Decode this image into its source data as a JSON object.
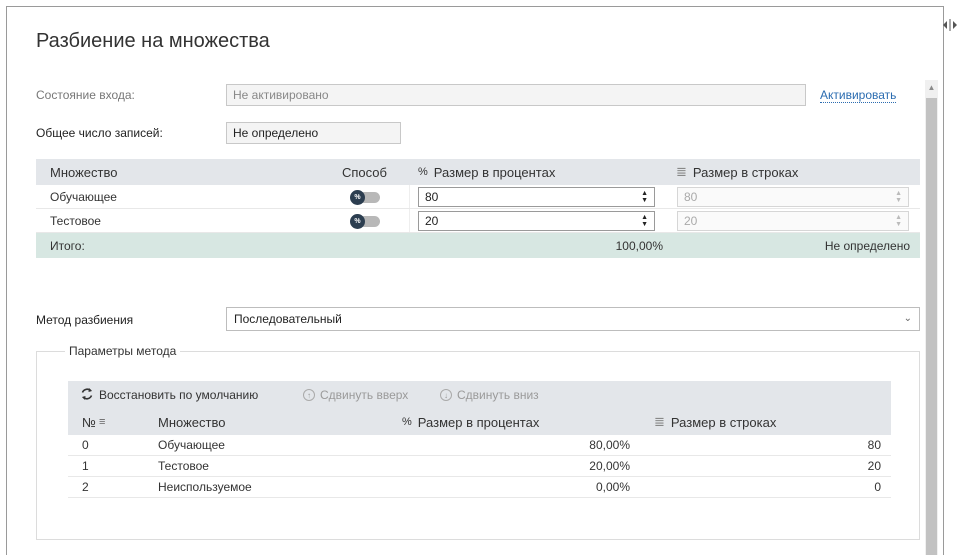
{
  "window": {
    "title": "Разбиение на множества"
  },
  "state": {
    "label": "Состояние входа:",
    "value": "Не активировано",
    "activate_link": "Активировать"
  },
  "records": {
    "label": "Общее число записей:",
    "value": "Не определено"
  },
  "split_table": {
    "headers": {
      "set": "Множество",
      "method": "Способ",
      "percent_icon": "%",
      "percent": "Размер в процентах",
      "rows_icon": "≣",
      "rows": "Размер в строках"
    },
    "rows": [
      {
        "name": "Обучающее",
        "toggle": "%",
        "percent": "80",
        "rows": "80"
      },
      {
        "name": "Тестовое",
        "toggle": "%",
        "percent": "20",
        "rows": "20"
      }
    ],
    "total": {
      "label": "Итого:",
      "percent": "100,00%",
      "rows": "Не определено"
    }
  },
  "method": {
    "label": "Метод разбиения",
    "value": "Последовательный"
  },
  "params": {
    "legend": "Параметры метода",
    "toolbar": {
      "restore": "Восстановить по умолчанию",
      "up": "Сдвинуть вверх",
      "down": "Сдвинуть вниз"
    },
    "headers": {
      "num": "№",
      "set": "Множество",
      "percent_icon": "%",
      "percent": "Размер в процентах",
      "rows_icon": "≣",
      "rows": "Размер в строках"
    },
    "rows": [
      {
        "num": "0",
        "set": "Обучающее",
        "percent": "80,00%",
        "rows": "80"
      },
      {
        "num": "1",
        "set": "Тестовое",
        "percent": "20,00%",
        "rows": "20"
      },
      {
        "num": "2",
        "set": "Неиспользуемое",
        "percent": "0,00%",
        "rows": "0"
      }
    ]
  },
  "icons": {
    "resize": "resize-handle-icon",
    "refresh": "refresh-icon",
    "arrow_up": "arrow-up-circle-icon",
    "arrow_down": "arrow-down-circle-icon",
    "sort": "sort-icon",
    "chevron": "chevron-down-icon"
  },
  "colors": {
    "header_bg": "#e3e6ea",
    "total_bg": "#d7e7e2",
    "link": "#2b6cb0",
    "toggle_knob": "#2c3e50"
  }
}
